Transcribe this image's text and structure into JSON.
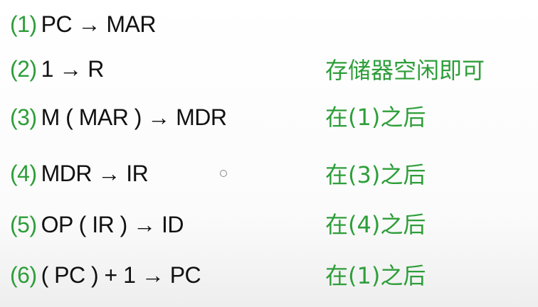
{
  "steps": [
    {
      "num": "(1)",
      "expr": "PC → MAR",
      "cond": ""
    },
    {
      "num": "(2)",
      "expr": "1 → R",
      "cond": "存储器空闲即可"
    },
    {
      "num": "(3)",
      "expr": "M ( MAR ) → MDR",
      "cond": "在(1)之后"
    },
    {
      "num": "(4)",
      "expr": "MDR → IR",
      "cond": "在(3)之后"
    },
    {
      "num": "(5)",
      "expr": "OP ( IR ) → ID",
      "cond": "在(4)之后"
    },
    {
      "num": "(6)",
      "expr": "( PC ) + 1 → PC",
      "cond": "在(1)之后"
    }
  ],
  "colors": {
    "accent": "#2e9e3a",
    "text": "#111111"
  }
}
